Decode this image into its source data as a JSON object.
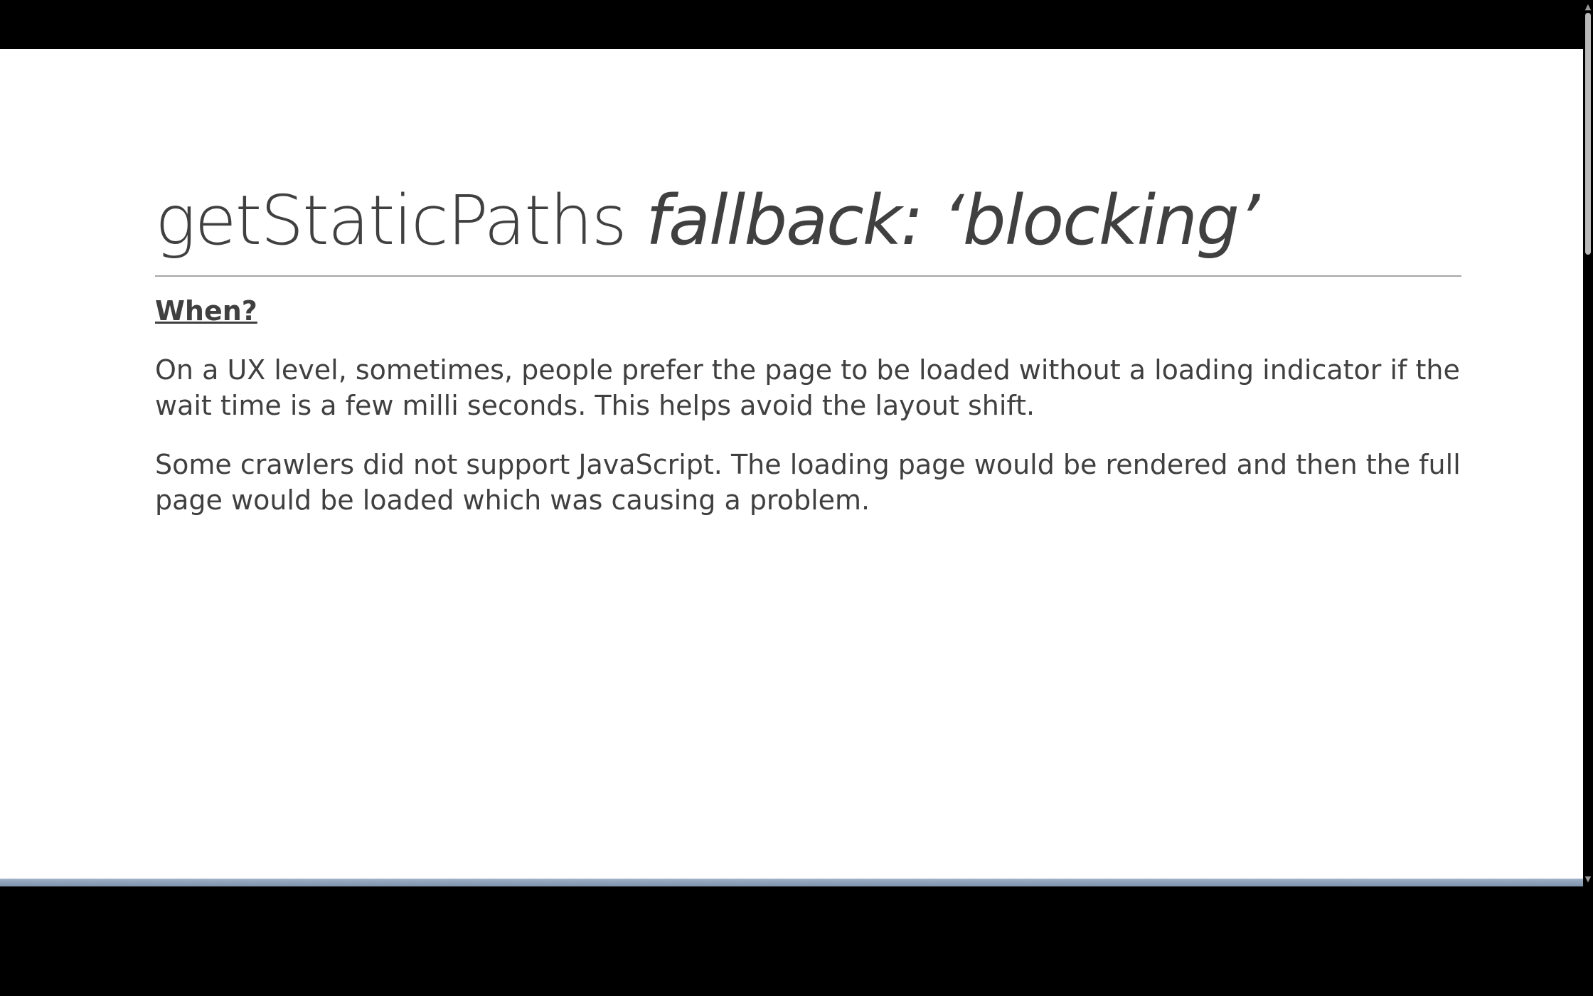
{
  "slide": {
    "title_regular": "getStaticPaths",
    "title_italic": "fallback: ‘blocking’",
    "heading": "When?",
    "paragraphs": [
      "On a UX level, sometimes, people prefer the page to be loaded without a loading indicator if the wait time is a few milli seconds. This helps avoid the layout shift.",
      "Some crawlers did not support JavaScript. The loading page would be rendered and then the full page would be loaded which was causing a problem."
    ]
  },
  "scrollbar": {
    "up_icon": "▲",
    "down_icon": "▼"
  },
  "colors": {
    "text": "#404040",
    "rule": "#a6a6a6",
    "background": "#ffffff",
    "frame": "#000000"
  }
}
